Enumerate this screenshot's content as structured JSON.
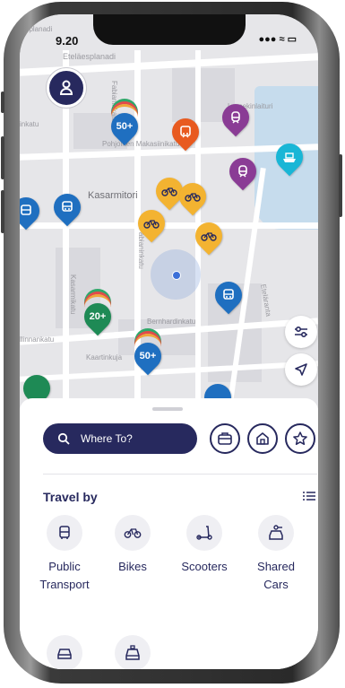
{
  "status_bar": {
    "time": "9.20",
    "icons": "●●● ≈ ▭"
  },
  "map": {
    "streets": {
      "top_left": "esplanadi",
      "top": "Eteläesplanadi",
      "lyypekin": "Lyypekinlaituri",
      "makasiini": "Pohjoinen Makasiinikatu",
      "bernhardin": "Bernhardinkatu",
      "kaartinkuja": "Kaartinkuja",
      "fabianinkatu1": "Fabianinkatu",
      "fabianinkatu2": "Fabianinkatu",
      "kasarmikatu": "Kasarmikatu",
      "linnankatu": "llinnankatu",
      "inkatu": "inkatu",
      "etelaranta": "Eteläranta"
    },
    "place": "Kasarmitori",
    "pins": {
      "pin50a": "50+",
      "pin50b": "50+",
      "pin20": "20+"
    }
  },
  "bottom_sheet": {
    "search_label": "Where To?",
    "travel_title": "Travel by",
    "categories": [
      {
        "label_line1": "Public",
        "label_line2": "Transport",
        "icon": "bus-icon"
      },
      {
        "label_line1": "Bikes",
        "label_line2": "",
        "icon": "bike-icon"
      },
      {
        "label_line1": "Scooters",
        "label_line2": "",
        "icon": "scooter-icon"
      },
      {
        "label_line1": "Shared",
        "label_line2": "Cars",
        "icon": "shared-car-icon"
      },
      {
        "label_line1": "",
        "label_line2": "",
        "icon": "car-icon"
      },
      {
        "label_line1": "",
        "label_line2": "",
        "icon": "taxi-icon"
      }
    ]
  },
  "colors": {
    "navy": "#27295e",
    "blue_pin": "#1f6fc0",
    "orange_pin": "#e85a1f",
    "purple_pin": "#8a3c95",
    "yellow_pin": "#f3b331",
    "cyan_pin": "#19b6d6",
    "green_pin": "#1e8a55"
  }
}
